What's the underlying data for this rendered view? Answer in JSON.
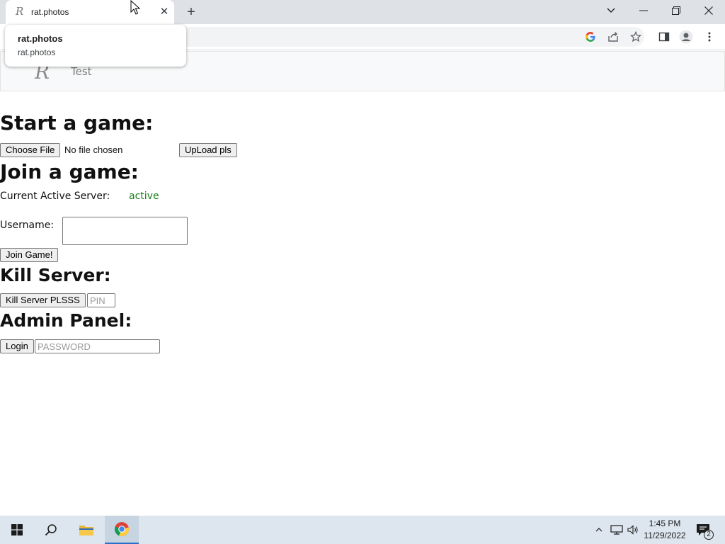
{
  "browser": {
    "tab_title": "rat.photos",
    "tab_favicon": "R",
    "hovercard": {
      "title": "rat.photos",
      "url": "rat.photos"
    }
  },
  "page": {
    "navbar": {
      "logo": "R",
      "link": "Test"
    },
    "start": {
      "heading": "Start a game:",
      "choose_file_label": "Choose File",
      "no_file_text": "No file chosen",
      "upload_label": "UpLoad pls"
    },
    "join": {
      "heading": "Join a game:",
      "server_label": "Current Active Server:",
      "server_status": "active",
      "username_label": "Username:",
      "username_value": "",
      "join_label": "Join Game!"
    },
    "kill": {
      "heading": "Kill Server:",
      "button_label": "Kill Server PLSSS",
      "pin_placeholder": "PIN"
    },
    "admin": {
      "heading": "Admin Panel:",
      "login_label": "Login",
      "password_placeholder": "PASSWORD"
    }
  },
  "taskbar": {
    "time": "1:45 PM",
    "date": "11/29/2022",
    "notification_count": "2"
  },
  "colors": {
    "status_active": "#1a7f1a",
    "taskbar": "#dde6ef",
    "tabstrip": "#dee1e6"
  }
}
